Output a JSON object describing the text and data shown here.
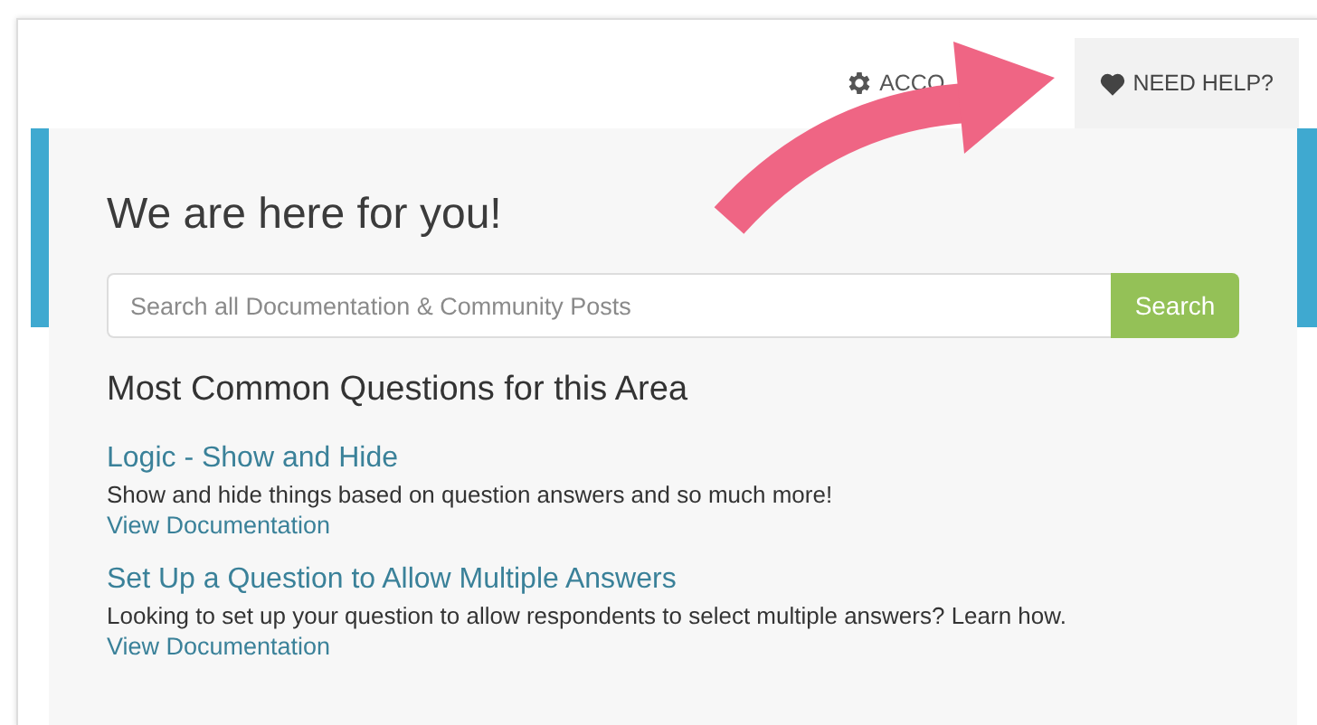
{
  "top_bar": {
    "account_label": "ACCO",
    "help_tab": {
      "label": "NEED HELP?",
      "selected": true
    }
  },
  "help_panel": {
    "title": "We are here for you!",
    "search": {
      "placeholder": "Search all Documentation & Community Posts",
      "button": "Search"
    },
    "section_title": "Most Common Questions for this Area",
    "questions": [
      {
        "title": "Logic - Show and Hide",
        "description": "Show and hide things based on question answers and so much more!",
        "link": "View Documentation"
      },
      {
        "title": "Set Up a Question to Allow Multiple Answers",
        "description": "Looking to set up your question to allow respondents to select multiple answers? Learn how.",
        "link": "View Documentation"
      }
    ]
  }
}
